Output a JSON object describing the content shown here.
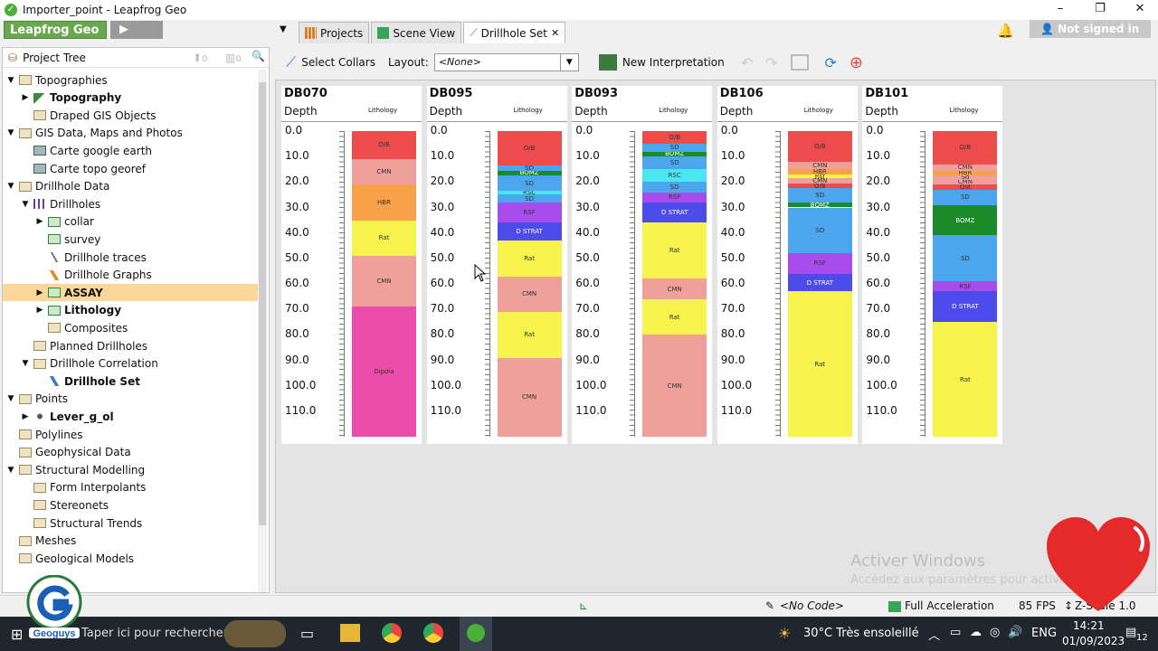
{
  "window": {
    "title": "Importer_point - Leapfrog Geo",
    "minimize": "–",
    "maximize": "❐",
    "close": "✕"
  },
  "topbar": {
    "brand": "Leapfrog Geo",
    "tabs": [
      {
        "label": "Projects",
        "icon": "grid-icon"
      },
      {
        "label": "Scene View",
        "icon": "cube-icon"
      },
      {
        "label": "Drillhole Set",
        "icon": "drillhole-set-icon",
        "close": "✕"
      }
    ],
    "signin": "Not signed in"
  },
  "project_tree": {
    "title": "Project Tree",
    "up_count": "0",
    "bar_count": "0",
    "nodes": [
      {
        "label": "Topographies",
        "level": 0,
        "arrow": "▼",
        "icon": "folder"
      },
      {
        "label": "Topography",
        "level": 1,
        "arrow": "▶",
        "icon": "topo",
        "bold": true
      },
      {
        "label": "Draped GIS Objects",
        "level": 1,
        "arrow": "",
        "icon": "folder"
      },
      {
        "label": "GIS Data, Maps and Photos",
        "level": 0,
        "arrow": "▼",
        "icon": "folder"
      },
      {
        "label": "Carte google earth",
        "level": 1,
        "arrow": "",
        "icon": "image"
      },
      {
        "label": "Carte topo georef",
        "level": 1,
        "arrow": "",
        "icon": "image"
      },
      {
        "label": "Drillhole Data",
        "level": 0,
        "arrow": "▼",
        "icon": "folder"
      },
      {
        "label": "Drillholes",
        "level": 1,
        "arrow": "▼",
        "icon": "drillholes"
      },
      {
        "label": "collar",
        "level": 2,
        "arrow": "▶",
        "icon": "table"
      },
      {
        "label": "survey",
        "level": 2,
        "arrow": "",
        "icon": "table"
      },
      {
        "label": "Drillhole traces",
        "level": 2,
        "arrow": "",
        "icon": "traces"
      },
      {
        "label": "Drillhole Graphs",
        "level": 2,
        "arrow": "",
        "icon": "graphs"
      },
      {
        "label": "ASSAY",
        "level": 2,
        "arrow": "▶",
        "icon": "table",
        "bold": true,
        "selected": true
      },
      {
        "label": "Lithology",
        "level": 2,
        "arrow": "▶",
        "icon": "table",
        "bold": true
      },
      {
        "label": "Composites",
        "level": 2,
        "arrow": "",
        "icon": "folder"
      },
      {
        "label": "Planned Drillholes",
        "level": 1,
        "arrow": "",
        "icon": "folder"
      },
      {
        "label": "Drillhole Correlation",
        "level": 1,
        "arrow": "▼",
        "icon": "folder"
      },
      {
        "label": "Drillhole Set",
        "level": 2,
        "arrow": "",
        "icon": "drillset",
        "bold": true
      },
      {
        "label": "Points",
        "level": 0,
        "arrow": "▼",
        "icon": "folder"
      },
      {
        "label": "Lever_g_ol",
        "level": 1,
        "arrow": "▶",
        "icon": "points",
        "bold": true
      },
      {
        "label": "Polylines",
        "level": 0,
        "arrow": "",
        "icon": "folder"
      },
      {
        "label": "Geophysical Data",
        "level": 0,
        "arrow": "",
        "icon": "folder"
      },
      {
        "label": "Structural Modelling",
        "level": 0,
        "arrow": "▼",
        "icon": "folder"
      },
      {
        "label": "Form Interpolants",
        "level": 1,
        "arrow": "",
        "icon": "folder"
      },
      {
        "label": "Stereonets",
        "level": 1,
        "arrow": "",
        "icon": "folder"
      },
      {
        "label": "Structural Trends",
        "level": 1,
        "arrow": "",
        "icon": "folder"
      },
      {
        "label": "Meshes",
        "level": 0,
        "arrow": "",
        "icon": "folder"
      },
      {
        "label": "Geological Models",
        "level": 0,
        "arrow": "",
        "icon": "folder"
      }
    ]
  },
  "toolbar": {
    "select_collars": "Select Collars",
    "layout_label": "Layout:",
    "layout_value": "<None>",
    "new_interpretation": "New Interpretation"
  },
  "drillhole_set": {
    "depth_label": "Depth",
    "column_label": "Lithology",
    "depth_ticks": [
      "0.0",
      "10.0",
      "20.0",
      "30.0",
      "40.0",
      "50.0",
      "60.0",
      "70.0",
      "80.0",
      "90.0",
      "100.0",
      "110.0"
    ],
    "max_depth": 120,
    "colors": {
      "O/B": "#ec4c4c",
      "CMN": "#f0a09a",
      "HBR": "#f7a248",
      "Rat": "#f6f44c",
      "Dipdia": "#ec4caa",
      "SD": "#4ca6ee",
      "BOMZ": "#1a8a2a",
      "RSC": "#4ce6f2",
      "RSF": "#a84cec",
      "D STRAT": "#4c4cea",
      "Rsf": "#f6f44c",
      "Sd": "#f0a09a",
      "Ost": "#ec4c4c"
    },
    "holes": [
      {
        "name": "DB070",
        "intervals": [
          {
            "code": "O/B",
            "from": 0,
            "to": 11
          },
          {
            "code": "CMN",
            "from": 11,
            "to": 21
          },
          {
            "code": "HBR",
            "from": 21,
            "to": 35
          },
          {
            "code": "Rat",
            "from": 35,
            "to": 49
          },
          {
            "code": "CMN",
            "from": 49,
            "to": 69
          },
          {
            "code": "Dipdia",
            "from": 69,
            "to": 120
          }
        ]
      },
      {
        "name": "DB095",
        "intervals": [
          {
            "code": "O/B",
            "from": 0,
            "to": 13.5
          },
          {
            "code": "SD",
            "from": 13.5,
            "to": 15.5
          },
          {
            "code": "BOMZ",
            "from": 15.5,
            "to": 17.5
          },
          {
            "code": "SD",
            "from": 17.5,
            "to": 23.5
          },
          {
            "code": "RSC",
            "from": 23.5,
            "to": 25
          },
          {
            "code": "SD",
            "from": 25,
            "to": 28
          },
          {
            "code": "RSF",
            "from": 28,
            "to": 36
          },
          {
            "code": "D STRAT",
            "from": 36,
            "to": 43
          },
          {
            "code": "Rat",
            "from": 43,
            "to": 57
          },
          {
            "code": "CMN",
            "from": 57,
            "to": 71
          },
          {
            "code": "Rat",
            "from": 71,
            "to": 89
          },
          {
            "code": "CMN",
            "from": 89,
            "to": 120
          }
        ]
      },
      {
        "name": "DB093",
        "intervals": [
          {
            "code": "O/B",
            "from": 0,
            "to": 5
          },
          {
            "code": "SD",
            "from": 5,
            "to": 8
          },
          {
            "code": "BOMZ",
            "from": 8,
            "to": 10
          },
          {
            "code": "SD",
            "from": 10,
            "to": 15
          },
          {
            "code": "RSC",
            "from": 15,
            "to": 20
          },
          {
            "code": "SD",
            "from": 20,
            "to": 24
          },
          {
            "code": "RSF",
            "from": 24,
            "to": 28
          },
          {
            "code": "D STRAT",
            "from": 28,
            "to": 36
          },
          {
            "code": "Rat",
            "from": 36,
            "to": 58
          },
          {
            "code": "CMN",
            "from": 58,
            "to": 66
          },
          {
            "code": "Rat",
            "from": 66,
            "to": 80
          },
          {
            "code": "CMN",
            "from": 80,
            "to": 120
          }
        ]
      },
      {
        "name": "DB106",
        "intervals": [
          {
            "code": "O/B",
            "from": 0,
            "to": 12
          },
          {
            "code": "CMN",
            "from": 12,
            "to": 15
          },
          {
            "code": "HBR",
            "from": 15,
            "to": 17
          },
          {
            "code": "Rsf",
            "from": 17,
            "to": 18.5
          },
          {
            "code": "CMN",
            "from": 18.5,
            "to": 20.5
          },
          {
            "code": "O/B",
            "from": 20.5,
            "to": 22.5
          },
          {
            "code": "SD",
            "from": 22.5,
            "to": 28
          },
          {
            "code": "BOMZ",
            "from": 28,
            "to": 30
          },
          {
            "code": "SD",
            "from": 30,
            "to": 48
          },
          {
            "code": "RSF",
            "from": 48,
            "to": 56
          },
          {
            "code": "D STRAT",
            "from": 56,
            "to": 63
          },
          {
            "code": "Rat",
            "from": 63,
            "to": 120
          }
        ]
      },
      {
        "name": "DB101",
        "intervals": [
          {
            "code": "O/B",
            "from": 0,
            "to": 13
          },
          {
            "code": "CMN",
            "from": 13,
            "to": 15.5
          },
          {
            "code": "HBR",
            "from": 15.5,
            "to": 17.5
          },
          {
            "code": "Sd",
            "from": 17.5,
            "to": 19
          },
          {
            "code": "CMN",
            "from": 19,
            "to": 21
          },
          {
            "code": "Ost",
            "from": 21,
            "to": 23
          },
          {
            "code": "SD",
            "from": 23,
            "to": 29
          },
          {
            "code": "BOMZ",
            "from": 29,
            "to": 41
          },
          {
            "code": "SD",
            "from": 41,
            "to": 59
          },
          {
            "code": "RSF",
            "from": 59,
            "to": 63
          },
          {
            "code": "D STRAT",
            "from": 63,
            "to": 75
          },
          {
            "code": "Rat",
            "from": 75,
            "to": 120
          }
        ]
      }
    ]
  },
  "watermark": {
    "line1": "Activer Windows",
    "line2": "Accédez aux paramètres pour activer"
  },
  "statusbar": {
    "code": "<No Code>",
    "accel": "Full Acceleration",
    "fps": "85 FPS",
    "zscale": "Z-Scale 1.0"
  },
  "taskbar": {
    "search": "Taper ici pour rechercher",
    "weather": "30°C  Très ensoleillé",
    "lang": "ENG",
    "time": "14:21",
    "date": "01/09/2023",
    "notif": "12"
  },
  "logo_text": "Geoguys"
}
